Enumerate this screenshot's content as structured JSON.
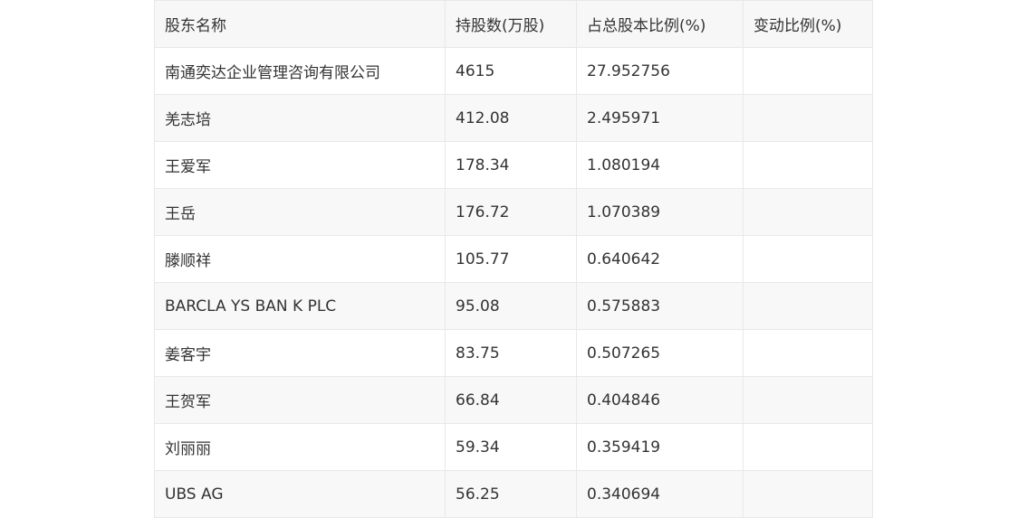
{
  "table": {
    "headers": [
      "股东名称",
      "持股数(万股)",
      "占总股本比例(%)",
      "变动比例(%)"
    ],
    "rows": [
      [
        "南通奕达企业管理咨询有限公司",
        "4615",
        "27.952756",
        ""
      ],
      [
        "羌志培",
        "412.08",
        "2.495971",
        ""
      ],
      [
        "王爱军",
        "178.34",
        "1.080194",
        ""
      ],
      [
        "王岳",
        "176.72",
        "1.070389",
        ""
      ],
      [
        "滕顺祥",
        "105.77",
        "0.640642",
        ""
      ],
      [
        "BARCLA YS BAN K PLC",
        "95.08",
        "0.575883",
        ""
      ],
      [
        "姜客宇",
        "83.75",
        "0.507265",
        ""
      ],
      [
        "王贺军",
        "66.84",
        "0.404846",
        ""
      ],
      [
        "刘丽丽",
        "59.34",
        "0.359419",
        ""
      ],
      [
        "UBS AG",
        "56.25",
        "0.340694",
        ""
      ]
    ]
  }
}
